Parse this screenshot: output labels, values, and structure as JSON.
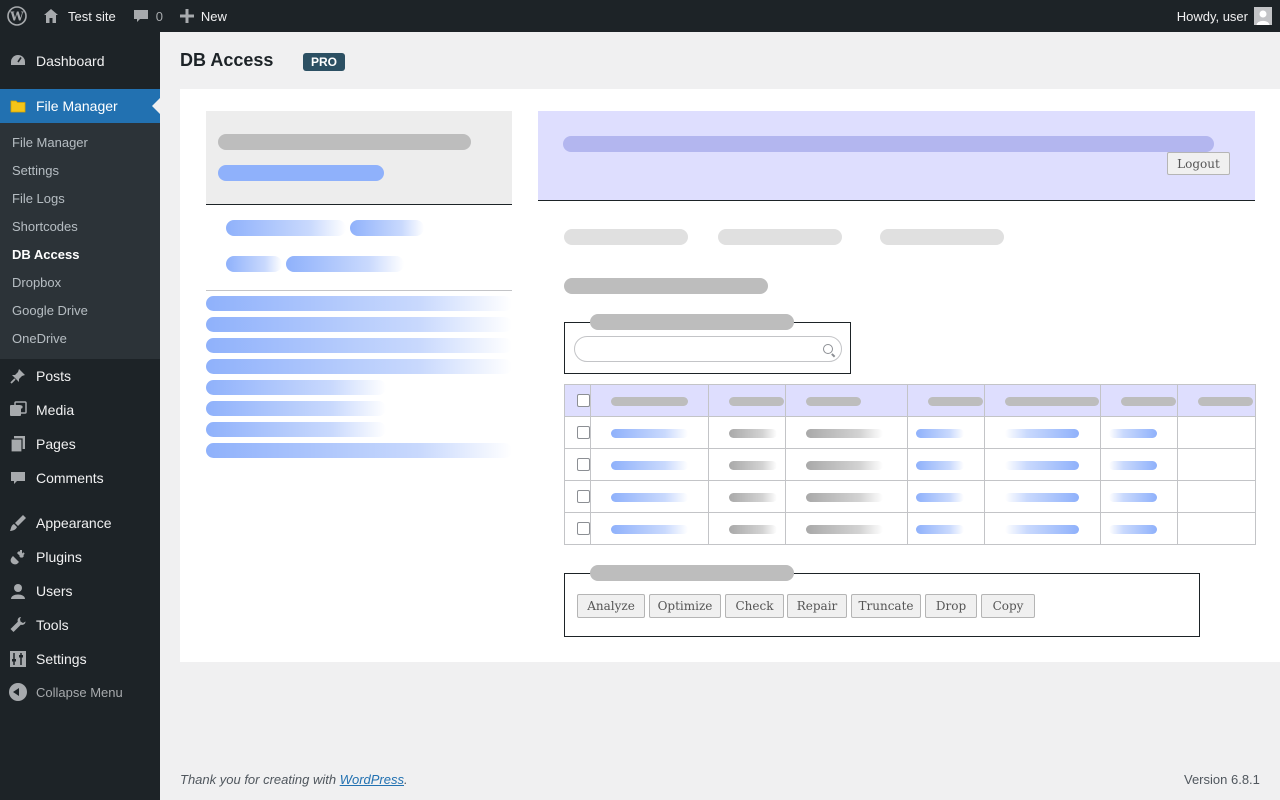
{
  "admin_bar": {
    "site_name": "Test site",
    "comments_count": "0",
    "new_label": "New",
    "greeting": "Howdy, user"
  },
  "sidebar": {
    "items": [
      {
        "label": "Dashboard",
        "icon": "dashboard-icon"
      },
      {
        "label": "File Manager",
        "icon": "folder-icon"
      },
      {
        "label": "Posts",
        "icon": "pin-icon"
      },
      {
        "label": "Media",
        "icon": "media-icon"
      },
      {
        "label": "Pages",
        "icon": "pages-icon"
      },
      {
        "label": "Comments",
        "icon": "comment-icon"
      },
      {
        "label": "Appearance",
        "icon": "brush-icon"
      },
      {
        "label": "Plugins",
        "icon": "plug-icon"
      },
      {
        "label": "Users",
        "icon": "user-icon"
      },
      {
        "label": "Tools",
        "icon": "wrench-icon"
      },
      {
        "label": "Settings",
        "icon": "sliders-icon"
      }
    ],
    "submenu": [
      "File Manager",
      "Settings",
      "File Logs",
      "Shortcodes",
      "DB Access",
      "Dropbox",
      "Google Drive",
      "OneDrive"
    ],
    "active_submenu": "DB Access",
    "collapse_label": "Collapse Menu"
  },
  "page": {
    "title": "DB Access",
    "badge": "PRO"
  },
  "db_panel": {
    "logout_label": "Logout",
    "actions": [
      "Analyze",
      "Optimize",
      "Check",
      "Repair",
      "Truncate",
      "Drop",
      "Copy"
    ]
  },
  "footer": {
    "thanks_prefix": "Thank you for creating with ",
    "thanks_link": "WordPress",
    "thanks_suffix": ".",
    "version": "Version 6.8.1"
  },
  "colors": {
    "accent": "#2271b1",
    "admin_bg": "#1d2327",
    "badge_bg": "#2c5063",
    "header_lavender": "#dedefe"
  }
}
